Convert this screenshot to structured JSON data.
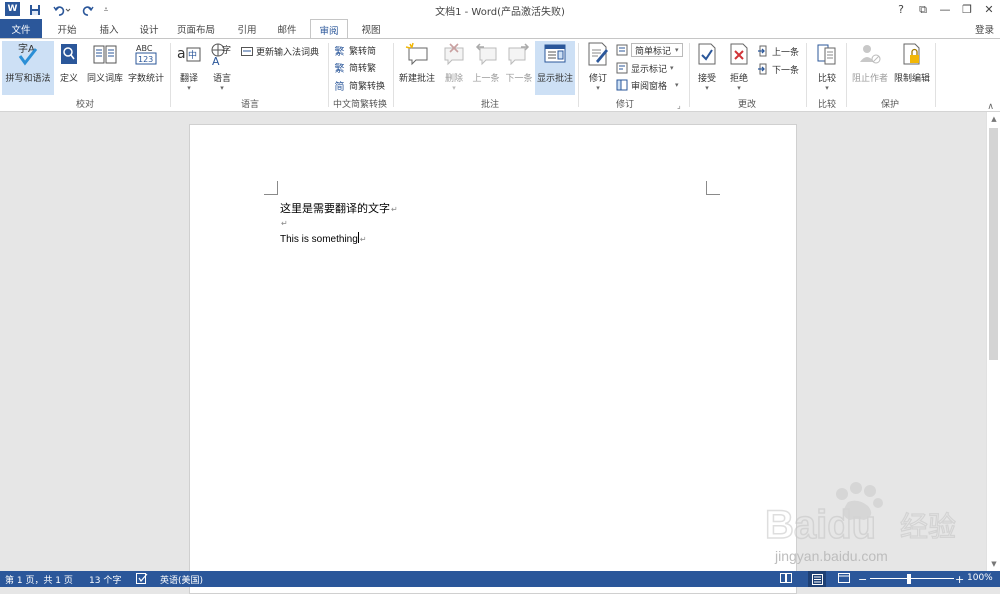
{
  "window": {
    "title": "文档1 - Word(产品激活失败)",
    "login": "登录",
    "controls": [
      "?",
      "⧉",
      "—",
      "❐",
      "✕"
    ]
  },
  "tabs": [
    "文件",
    "开始",
    "插入",
    "设计",
    "页面布局",
    "引用",
    "邮件",
    "审阅",
    "视图"
  ],
  "active_tab": "审阅",
  "ribbon": {
    "proofing": {
      "spelling": "拼写和语法",
      "define": "定义",
      "thesaurus": "同义词库",
      "word_count": "字数统计",
      "label": "校对"
    },
    "language": {
      "translate": "翻译",
      "language": "语言",
      "update_ime": "更新输入法词典",
      "label": "语言"
    },
    "chinese_conversion": {
      "to_simplified": "繁转简",
      "to_traditional": "简转繁",
      "conversion": "简繁转换",
      "label": "中文简繁转换"
    },
    "comments": {
      "new": "新建批注",
      "delete": "删除",
      "prev": "上一条",
      "next": "下一条",
      "show": "显示批注",
      "label": "批注"
    },
    "tracking": {
      "track": "修订",
      "markup_select": "简单标记",
      "show_markup": "显示标记",
      "review_pane": "审阅窗格",
      "label": "修订"
    },
    "changes": {
      "accept": "接受",
      "reject": "拒绝",
      "prev": "上一条",
      "next": "下一条",
      "label": "更改"
    },
    "compare": {
      "compare": "比较",
      "label": "比较"
    },
    "protect": {
      "block_authors": "阻止作者",
      "restrict": "限制编辑",
      "label": "保护"
    }
  },
  "document": {
    "line1": "这里是需要翻译的文字",
    "line2": "",
    "line3": "This is something",
    "para_mark": "↵"
  },
  "status": {
    "page": "第 1 页，共 1 页",
    "words": "13 个字",
    "language": "英语(美国)",
    "zoom": "100%"
  },
  "watermark": {
    "brand": "Baidu",
    "sub": "经验",
    "url": "jingyan.baidu.com"
  },
  "colors": {
    "brand": "#2b579a",
    "accent_hl": "#cde0f5"
  }
}
